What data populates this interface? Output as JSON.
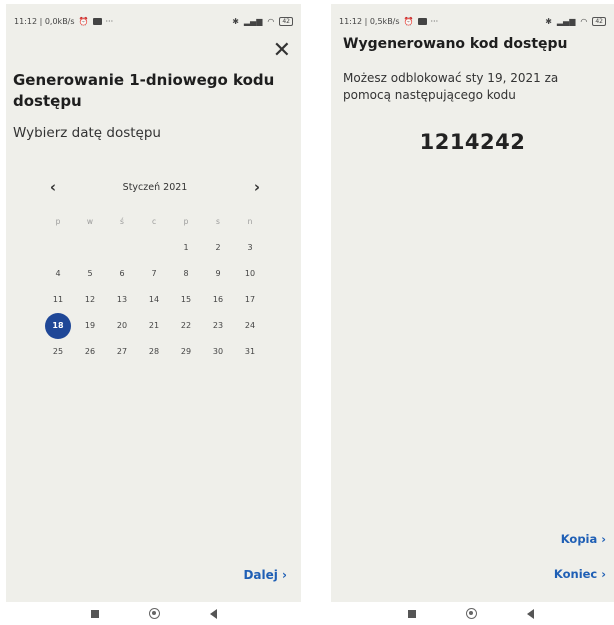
{
  "left": {
    "status": {
      "time": "11:12 | 0,0kB/s",
      "battery": "42",
      "more": "···"
    },
    "close_icon": "✕",
    "title": "Generowanie 1-dniowego kodu dostępu",
    "subtitle": "Wybierz datę dostępu",
    "calendar": {
      "month_label": "Styczeń 2021",
      "prev": "‹",
      "next": "›",
      "weekdays": [
        "p",
        "w",
        "ś",
        "c",
        "p",
        "s",
        "n"
      ],
      "weeks": [
        [
          "",
          "",
          "",
          "",
          "1",
          "2",
          "3"
        ],
        [
          "4",
          "5",
          "6",
          "7",
          "8",
          "9",
          "10"
        ],
        [
          "11",
          "12",
          "13",
          "14",
          "15",
          "16",
          "17"
        ],
        [
          "18",
          "19",
          "20",
          "21",
          "22",
          "23",
          "24"
        ],
        [
          "25",
          "26",
          "27",
          "28",
          "29",
          "30",
          "31"
        ]
      ],
      "selected_day": "18",
      "selected_color": "#1f4797"
    },
    "next_button": "Dalej ›"
  },
  "right": {
    "status": {
      "time": "11:12 | 0,5kB/s",
      "battery": "42",
      "more": "···"
    },
    "title": "Wygenerowano kod dostępu",
    "description": "Możesz odblokować sty 19, 2021 za pomocą następującego kodu",
    "code": "1214242",
    "copy_button": "Kopia ›",
    "end_button": "Koniec ›"
  },
  "accent_color": "#1f5fb5"
}
